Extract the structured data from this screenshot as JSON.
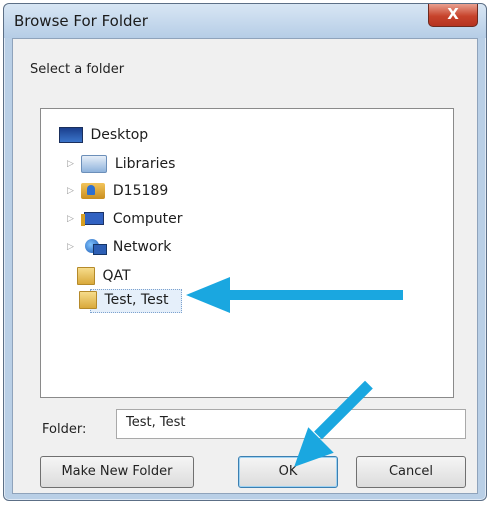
{
  "window": {
    "title": "Browse For Folder",
    "close_glyph": "X"
  },
  "prompt": "Select a folder",
  "tree": {
    "items": [
      {
        "label": "Desktop",
        "icon": "desktop-icon",
        "expandable": false
      },
      {
        "label": "Libraries",
        "icon": "libraries-icon",
        "expandable": true
      },
      {
        "label": "D15189",
        "icon": "user-folder-icon",
        "expandable": true
      },
      {
        "label": "Computer",
        "icon": "computer-icon",
        "expandable": true
      },
      {
        "label": "Network",
        "icon": "network-icon",
        "expandable": true
      },
      {
        "label": "QAT",
        "icon": "folder-icon",
        "expandable": false
      },
      {
        "label": "Test, Test",
        "icon": "folder-icon",
        "expandable": false,
        "selected": true
      }
    ],
    "expander_glyph": "▷"
  },
  "folder_field": {
    "label": "Folder:",
    "value": "Test, Test"
  },
  "buttons": {
    "new_folder": "Make New Folder",
    "ok": "OK",
    "cancel": "Cancel"
  },
  "colors": {
    "callout_arrow": "#1aa7e0",
    "close_button": "#c7432c"
  }
}
